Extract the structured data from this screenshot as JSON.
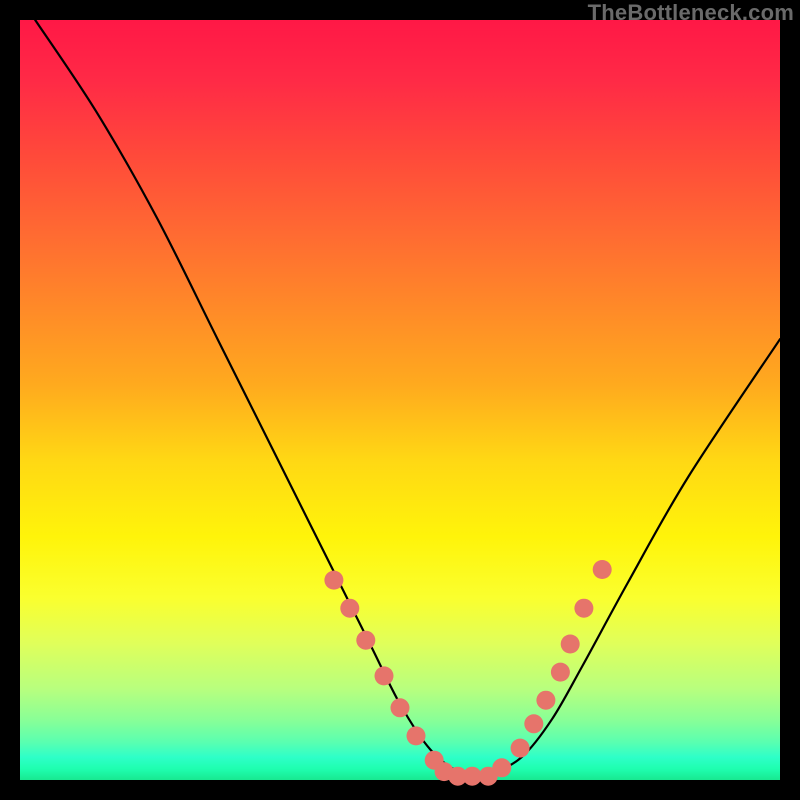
{
  "watermark": "TheBottleneck.com",
  "chart_data": {
    "type": "line",
    "title": "",
    "xlabel": "",
    "ylabel": "",
    "xlim": [
      0,
      100
    ],
    "ylim": [
      0,
      100
    ],
    "grid": false,
    "series": [
      {
        "name": "main-curve",
        "x": [
          2,
          10,
          18,
          26,
          34,
          40,
          46,
          50,
          54,
          58,
          62,
          66,
          70,
          74,
          80,
          88,
          100
        ],
        "values": [
          100,
          88,
          74,
          58,
          42,
          30,
          18,
          10,
          4,
          1,
          1,
          3,
          8,
          15,
          26,
          40,
          58
        ]
      }
    ],
    "markers": {
      "name": "highlight-dots",
      "x": [
        41.3,
        43.4,
        45.5,
        47.9,
        50.0,
        52.1,
        54.5,
        55.8,
        57.6,
        59.5,
        61.6,
        63.4,
        65.8,
        67.6,
        69.2,
        71.1,
        72.4,
        74.2,
        76.6
      ],
      "y": [
        26.3,
        22.6,
        18.4,
        13.7,
        9.5,
        5.8,
        2.6,
        1.1,
        0.5,
        0.5,
        0.5,
        1.6,
        4.2,
        7.4,
        10.5,
        14.2,
        17.9,
        22.6,
        27.7
      ]
    }
  }
}
